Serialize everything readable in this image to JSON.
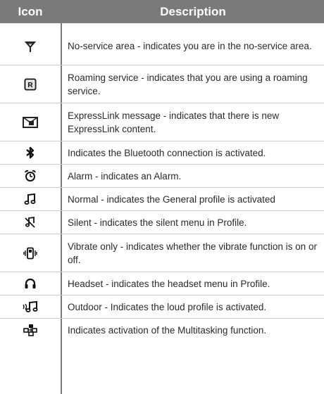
{
  "header": {
    "icon_col": "Icon",
    "desc_col": "Description"
  },
  "rows": [
    {
      "icon": "no-service-antenna-icon",
      "text": "No-service area - indicates you are in the no-service area."
    },
    {
      "icon": "roaming-r-icon",
      "text": "Roaming service - indicates that you are using a roaming service."
    },
    {
      "icon": "expresslink-envelope-icon",
      "text": "ExpressLink message - indicates that there is new ExpressLink content."
    },
    {
      "icon": "bluetooth-icon",
      "text": "Indicates the Bluetooth connection is activated."
    },
    {
      "icon": "alarm-clock-icon",
      "text": "Alarm - indicates an Alarm."
    },
    {
      "icon": "music-note-icon",
      "text": "Normal - indicates the General profile is activated"
    },
    {
      "icon": "silent-icon",
      "text": "Silent - indicates the silent menu in Profile."
    },
    {
      "icon": "vibrate-icon",
      "text": "Vibrate only - indicates whether the vibrate function is on or off."
    },
    {
      "icon": "headset-icon",
      "text": "Headset - indicates the headset menu in Profile."
    },
    {
      "icon": "outdoor-loud-icon",
      "text": "Outdoor - Indicates the loud profile is activated."
    },
    {
      "icon": "multitasking-icon",
      "text": "Indicates activation of the Multitasking function."
    }
  ]
}
